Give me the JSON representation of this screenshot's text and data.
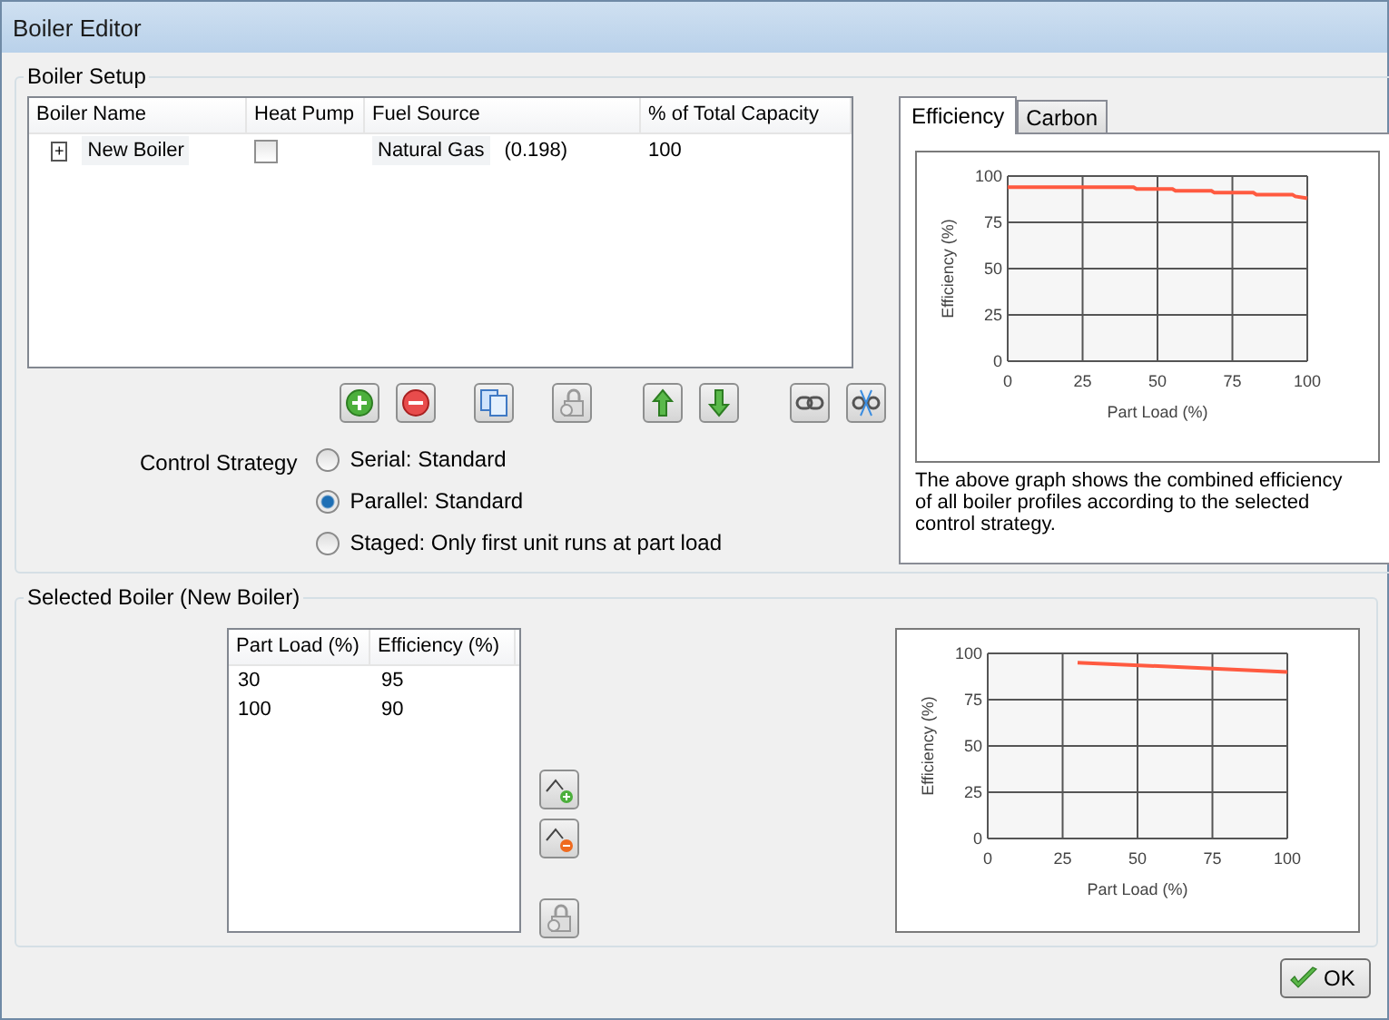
{
  "window": {
    "title": "Boiler Editor"
  },
  "boiler_setup": {
    "title": "Boiler Setup",
    "table": {
      "columns": [
        "Boiler Name",
        "Heat Pump",
        "Fuel Source",
        "% of Total Capacity"
      ],
      "rows": [
        {
          "expander": "+",
          "name": "New Boiler",
          "heat_pump": false,
          "fuel_source": "Natural Gas",
          "fuel_factor": "(0.198)",
          "capacity": "100"
        }
      ]
    },
    "toolbar": [
      {
        "kind": "add"
      },
      {
        "kind": "remove"
      },
      {
        "kind": "copy"
      },
      {
        "kind": "locked"
      },
      {
        "kind": "up"
      },
      {
        "kind": "down"
      },
      {
        "kind": "link"
      },
      {
        "kind": "unlink"
      }
    ],
    "control_strategy": {
      "label": "Control Strategy",
      "options": [
        {
          "label": "Serial: Standard",
          "selected": false
        },
        {
          "label": "Parallel: Standard",
          "selected": true
        },
        {
          "label": "Staged: Only first unit runs at part load",
          "selected": false
        }
      ]
    },
    "tabs": [
      {
        "label": "Efficiency",
        "selected": true
      },
      {
        "label": "Carbon",
        "selected": false
      }
    ],
    "chart_data": {
      "type": "line",
      "xlabel": "Part Load (%)",
      "ylabel": "Efficiency (%)",
      "x": [
        0,
        42,
        43,
        55,
        56,
        68,
        69,
        82,
        83,
        95,
        96,
        100
      ],
      "series": [
        {
          "color": "#ff5a40",
          "values": [
            94,
            94,
            93,
            93,
            92,
            92,
            91,
            91,
            90,
            90,
            89,
            88
          ]
        }
      ],
      "grid": true,
      "xlim": [
        0,
        100
      ],
      "ylim": [
        0,
        100
      ],
      "xticks": [
        0,
        25,
        50,
        75,
        100
      ],
      "yticks": [
        0,
        25,
        50,
        75,
        100
      ]
    },
    "note": "The above graph shows the combined efficiency of all boiler profiles according to the selected control strategy."
  },
  "selected_boiler": {
    "title": "Selected Boiler (New Boiler)",
    "table": {
      "columns": [
        "Part Load (%)",
        "Efficiency (%)"
      ],
      "rows": [
        [
          "30",
          "95"
        ],
        [
          "100",
          "90"
        ]
      ]
    },
    "side_buttons": [
      {
        "kind": "add_point"
      },
      {
        "kind": "remove_point"
      },
      {
        "kind": "locked"
      }
    ],
    "chart_data": {
      "type": "line",
      "xlabel": "Part Load (%)",
      "ylabel": "Efficiency (%)",
      "x": [
        30,
        100
      ],
      "series": [
        {
          "color": "#ff5a40",
          "values": [
            95,
            90
          ]
        }
      ],
      "grid": true,
      "xlim": [
        0,
        100
      ],
      "ylim": [
        0,
        100
      ],
      "xticks": [
        0,
        25,
        50,
        75,
        100
      ],
      "yticks": [
        0,
        25,
        50,
        75,
        100
      ]
    }
  },
  "buttons": [
    {
      "label": "OK",
      "kind": "ok"
    }
  ]
}
